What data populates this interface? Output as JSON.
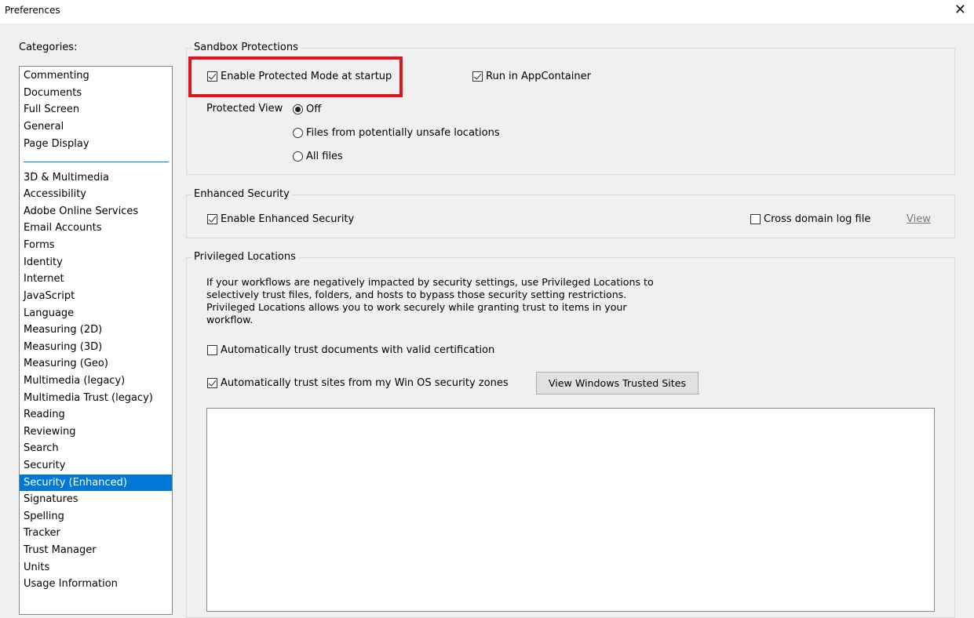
{
  "window": {
    "title": "Preferences",
    "close_glyph": "✕"
  },
  "categories": {
    "label": "Categories:",
    "group1": [
      "Commenting",
      "Documents",
      "Full Screen",
      "General",
      "Page Display"
    ],
    "group2": [
      "3D & Multimedia",
      "Accessibility",
      "Adobe Online Services",
      "Email Accounts",
      "Forms",
      "Identity",
      "Internet",
      "JavaScript",
      "Language",
      "Measuring (2D)",
      "Measuring (3D)",
      "Measuring (Geo)",
      "Multimedia (legacy)",
      "Multimedia Trust (legacy)",
      "Reading",
      "Reviewing",
      "Search",
      "Security",
      "Security (Enhanced)",
      "Signatures",
      "Spelling",
      "Tracker",
      "Trust Manager",
      "Units",
      "Usage Information"
    ],
    "selected": "Security (Enhanced)"
  },
  "sandbox": {
    "title": "Sandbox Protections",
    "protected_mode_label": "Enable Protected Mode at startup",
    "protected_mode_checked": true,
    "appcontainer_label": "Run in AppContainer",
    "appcontainer_checked": true,
    "protected_view_label": "Protected View",
    "options": [
      {
        "label": "Off",
        "selected": true
      },
      {
        "label": "Files from potentially unsafe locations",
        "selected": false
      },
      {
        "label": "All files",
        "selected": false
      }
    ]
  },
  "enhanced": {
    "title": "Enhanced Security",
    "enable_label": "Enable Enhanced Security",
    "enable_checked": true,
    "cross_domain_label": "Cross domain log file",
    "cross_domain_checked": false,
    "view_link": "View"
  },
  "privileged": {
    "title": "Privileged Locations",
    "description_lines": [
      "If your workflows are negatively impacted by security settings, use Privileged Locations to",
      "selectively trust files, folders, and hosts to bypass those security setting restrictions.",
      "Privileged Locations allows you to work securely while granting trust to items in your",
      "workflow."
    ],
    "auto_trust_cert_label": "Automatically trust documents with valid certification",
    "auto_trust_cert_checked": false,
    "auto_trust_sites_label": "Automatically trust sites from my Win OS security zones",
    "auto_trust_sites_checked": true,
    "view_sites_button": "View Windows Trusted Sites"
  },
  "colors": {
    "highlight": "#e0141e",
    "selection": "#0078d7"
  }
}
